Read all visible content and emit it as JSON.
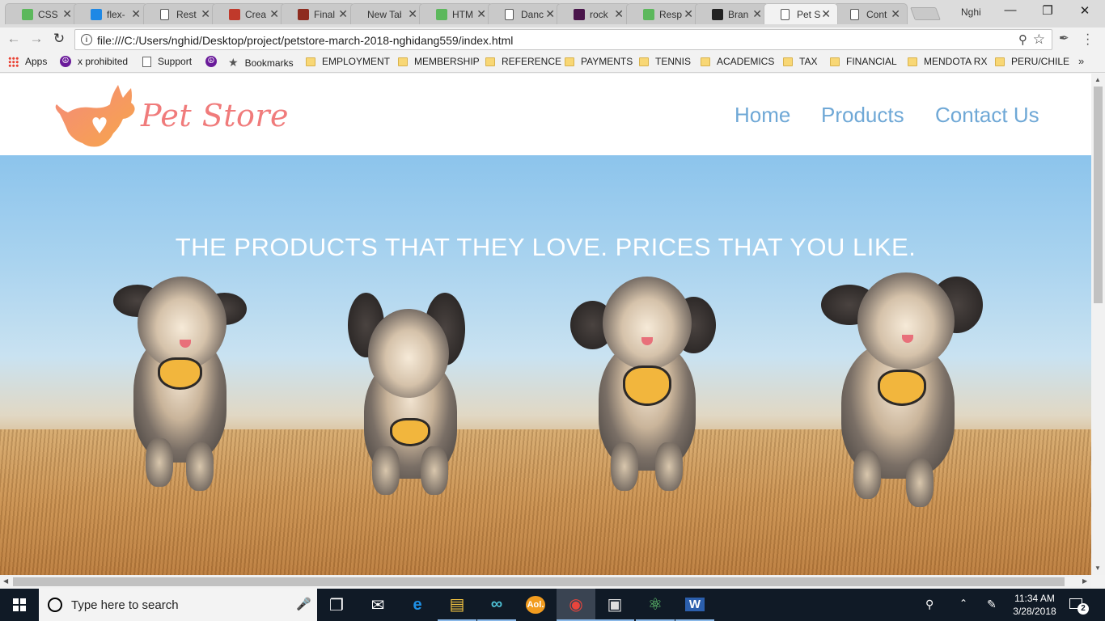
{
  "browser": {
    "tabs": [
      {
        "title": "CSS",
        "favicon": "w3-icon",
        "color": "#5cb85c"
      },
      {
        "title": "flex-",
        "favicon": "bird-icon",
        "color": "#1e88e5"
      },
      {
        "title": "Rest",
        "favicon": "page-icon",
        "color": ""
      },
      {
        "title": "Crea",
        "favicon": "s-icon",
        "color": "#c0392b"
      },
      {
        "title": "Final",
        "favicon": "monkey-icon",
        "color": "#8e2c1f"
      },
      {
        "title": "New Tab",
        "favicon": "",
        "color": ""
      },
      {
        "title": "HTM",
        "favicon": "w3-icon",
        "color": "#5cb85c"
      },
      {
        "title": "Danc",
        "favicon": "page-icon",
        "color": ""
      },
      {
        "title": "rock",
        "favicon": "slack-icon",
        "color": "#4a154b"
      },
      {
        "title": "Resp",
        "favicon": "w3-icon",
        "color": "#5cb85c"
      },
      {
        "title": "Bran",
        "favicon": "github-icon",
        "color": "#222222"
      },
      {
        "title": "Pet S",
        "favicon": "page-icon",
        "color": "",
        "active": true
      },
      {
        "title": "Cont",
        "favicon": "page-icon",
        "color": ""
      }
    ],
    "profile_name": "Nghi",
    "url": "file:///C:/Users/nghid/Desktop/project/petstore-march-2018-nghidang559/index.html",
    "bookmarks": [
      {
        "label": "Apps",
        "icon": "apps-grid-icon"
      },
      {
        "label": "x prohibited",
        "icon": "peace-icon"
      },
      {
        "label": "Support",
        "icon": "page-icon"
      },
      {
        "label": "",
        "icon": "peace-icon"
      },
      {
        "label": "Bookmarks",
        "icon": "star-icon"
      },
      {
        "label": "EMPLOYMENT",
        "icon": "folder-icon"
      },
      {
        "label": "MEMBERSHIP",
        "icon": "folder-icon"
      },
      {
        "label": "REFERENCE",
        "icon": "folder-icon"
      },
      {
        "label": "PAYMENTS",
        "icon": "folder-icon"
      },
      {
        "label": "TENNIS",
        "icon": "folder-icon"
      },
      {
        "label": "ACADEMICS",
        "icon": "folder-icon"
      },
      {
        "label": "TAX",
        "icon": "folder-icon"
      },
      {
        "label": "FINANCIAL",
        "icon": "folder-icon"
      },
      {
        "label": "MENDOTA RX",
        "icon": "folder-icon"
      },
      {
        "label": "PERU/CHILE",
        "icon": "folder-icon"
      }
    ],
    "overflow_glyph": "»"
  },
  "site": {
    "brand": "Pet Store",
    "nav": [
      "Home",
      "Products",
      "Contact Us"
    ],
    "hero_text": "THE PRODUCTS THAT THEY LOVE. PRICES THAT YOU LIKE.",
    "brand_color": "#f07b7b",
    "nav_color": "#6fa8d6"
  },
  "taskbar": {
    "search_placeholder": "Type here to search",
    "time": "11:34 AM",
    "date": "3/28/2018",
    "notification_count": "2",
    "apps": [
      "task-view-icon",
      "mail-icon",
      "edge-icon",
      "file-explorer-icon",
      "infinity-icon",
      "aol-icon",
      "chrome-icon",
      "terminal-icon",
      "atom-icon",
      "word-icon"
    ]
  }
}
